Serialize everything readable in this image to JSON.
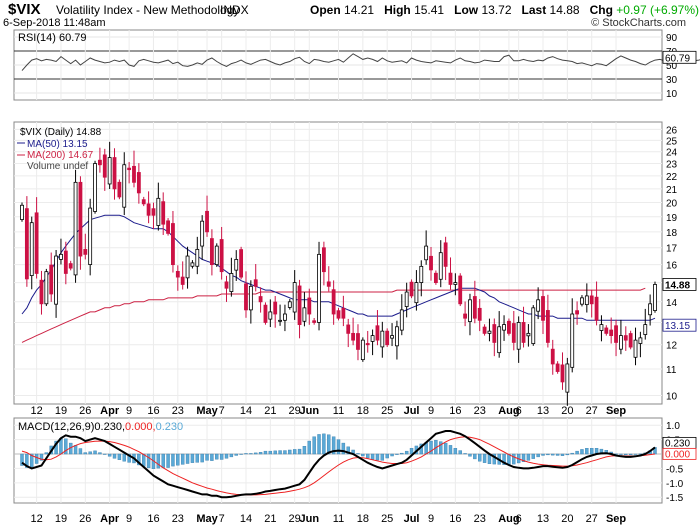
{
  "header": {
    "symbol": "$VIX",
    "name": "Volatility Index - New Methodology",
    "exchange": "INDX",
    "datetime": "6-Sep-2018 11:48am",
    "copyright": "© StockCharts.com",
    "open_label": "Open",
    "open": "14.21",
    "high_label": "High",
    "high": "15.41",
    "low_label": "Low",
    "low": "13.72",
    "last_label": "Last",
    "last": "14.88",
    "chg_label": "Chg",
    "chg": "+0.97 (+6.97%)"
  },
  "colors": {
    "up": "#00aa00",
    "bar_up": "#ffffff",
    "bar_down": "#cc1144",
    "ma50": "#1c1c8c",
    "ma200": "#cc2244",
    "macd_hist": "#5aa9d6",
    "macd_line": "#000000",
    "macd_signal": "#ee2222"
  },
  "chart_data": [
    {
      "type": "line",
      "panel": "rsi",
      "label": "RSI(14) 60.79",
      "y_ticks": [
        90,
        70,
        50,
        30,
        10
      ],
      "ylim": [
        0,
        100
      ],
      "reference_lines": [
        70,
        30
      ],
      "last_value_tag": "60.79",
      "values": [
        42,
        50,
        57,
        59,
        56,
        58,
        57,
        55,
        62,
        57,
        52,
        57,
        50,
        55,
        60,
        57,
        55,
        53,
        54,
        57,
        55,
        57,
        50,
        48,
        56,
        58,
        56,
        54,
        53,
        55,
        57,
        52,
        54,
        49,
        48,
        50,
        53,
        51,
        57,
        60,
        55,
        51,
        48,
        52,
        54,
        57,
        53,
        51,
        54,
        57,
        58,
        55,
        52,
        50,
        53,
        55,
        59,
        61,
        55,
        52,
        58,
        57,
        55,
        54,
        56,
        58,
        54,
        60,
        66,
        62,
        58,
        60,
        58,
        55,
        60,
        56,
        54,
        55,
        56,
        53,
        60,
        57,
        55,
        54,
        53,
        56,
        55,
        54,
        53,
        57,
        60,
        56,
        55,
        53,
        54,
        57,
        56,
        55,
        55,
        62,
        64,
        56,
        56,
        58,
        56,
        55,
        57,
        56,
        60,
        62,
        59,
        57,
        56,
        55,
        52,
        53,
        51,
        49,
        52,
        51,
        49,
        54,
        59,
        63,
        60,
        57,
        55,
        52,
        50,
        54,
        57,
        58,
        56,
        55,
        58,
        55,
        53,
        56,
        56,
        57,
        59,
        61
      ]
    },
    {
      "type": "candlestick",
      "panel": "price",
      "legend": [
        "$VIX (Daily) 14.88",
        "MA(50) 13.15",
        "MA(200) 14.67",
        "Volume undef"
      ],
      "y_ticks": [
        26,
        25,
        24,
        23,
        22,
        21,
        20,
        19,
        18,
        17,
        16,
        15,
        14,
        13,
        12,
        11,
        10
      ],
      "y_scale": "log",
      "ylim": [
        9.7,
        26.7
      ],
      "last_tags": {
        "price": "14.88",
        "ma50": "13.15"
      },
      "close": [
        19.8,
        15.2,
        18.6,
        15.5,
        13.9,
        15.6,
        14.4,
        16.5,
        16.6,
        15.5,
        15.8,
        21.5,
        16.5,
        16.6,
        19.6,
        23.0,
        22.9,
        21.9,
        23.5,
        21.0,
        20.4,
        22.9,
        22.5,
        21.5,
        20.7,
        19.9,
        19.1,
        19.1,
        20.3,
        18.5,
        17.9,
        16.0,
        15.3,
        14.9,
        16.5,
        16.1,
        16.9,
        18.7,
        18.0,
        16.0,
        17.1,
        15.6,
        14.7,
        15.5,
        16.3,
        15.3,
        13.6,
        14.8,
        14.8,
        14.0,
        13.0,
        13.5,
        13.4,
        13.1,
        13.4,
        14.0,
        15.0,
        12.9,
        13.7,
        13.4,
        13.0,
        16.6,
        15.6,
        14.8,
        13.4,
        13.2,
        13.2,
        12.5,
        12.2,
        11.8,
        12.2,
        12.0,
        12.4,
        12.2,
        12.6,
        12.0,
        12.4,
        12.8,
        13.6,
        14.5,
        14.3,
        15.0,
        15.9,
        17.1,
        15.7,
        15.0,
        16.7,
        15.9,
        14.9,
        15.0,
        13.9,
        13.2,
        14.1,
        13.2,
        13.1,
        12.5,
        12.6,
        12.1,
        12.8,
        12.9,
        12.5,
        12.1,
        13.0,
        12.1,
        12.5,
        13.7,
        14.1,
        13.1,
        12.1,
        11.2,
        10.9,
        10.5,
        11.2,
        13.4,
        13.4,
        14.2,
        14.3,
        13.9,
        13.1,
        12.9,
        12.5,
        12.4,
        12.1,
        12.4,
        12.2,
        11.9,
        12.2,
        12.3,
        12.9,
        13.9,
        14.9
      ],
      "ma50": [
        13.4,
        13.7,
        14.2,
        14.6,
        14.9,
        15.3,
        15.7,
        16.2,
        16.7,
        17.1,
        17.5,
        17.9,
        18.2,
        18.5,
        18.8,
        18.9,
        19.0,
        19.1,
        19.1,
        19.1,
        19.1,
        19.0,
        18.8,
        18.6,
        18.5,
        18.4,
        18.3,
        18.2,
        18.2,
        18.2,
        18.0,
        17.7,
        17.4,
        17.1,
        16.9,
        16.7,
        16.5,
        16.3,
        16.2,
        16.1,
        16.0,
        15.8,
        15.6,
        15.4,
        15.3,
        15.1,
        15.0,
        14.9,
        14.8,
        14.7,
        14.6,
        14.6,
        14.5,
        14.4,
        14.3,
        14.2,
        14.1,
        14.1,
        14.1,
        14.1,
        14.0,
        14.0,
        14.0,
        14.0,
        13.9,
        13.8,
        13.7,
        13.6,
        13.5,
        13.4,
        13.4,
        13.3,
        13.3,
        13.3,
        13.3,
        13.3,
        13.3,
        13.4,
        13.5,
        13.6,
        13.7,
        13.8,
        13.9,
        14.0,
        14.1,
        14.2,
        14.3,
        14.4,
        14.5,
        14.6,
        14.7,
        14.7,
        14.7,
        14.7,
        14.6,
        14.5,
        14.3,
        14.2,
        14.0,
        13.9,
        13.8,
        13.7,
        13.6,
        13.5,
        13.4,
        13.4,
        13.3,
        13.3,
        13.3,
        13.3,
        13.2,
        13.2,
        13.2,
        13.2,
        13.2,
        13.2,
        13.1,
        13.1,
        13.1,
        13.1,
        13.1,
        13.1,
        13.1,
        13.1,
        13.1,
        13.1,
        13.1,
        13.1,
        13.1,
        13.1,
        13.2
      ],
      "ma200": [
        12.1,
        12.2,
        12.3,
        12.4,
        12.5,
        12.6,
        12.7,
        12.8,
        12.9,
        13.0,
        13.1,
        13.2,
        13.3,
        13.4,
        13.5,
        13.5,
        13.6,
        13.7,
        13.7,
        13.8,
        13.8,
        13.9,
        13.9,
        14.0,
        14.0,
        14.0,
        14.1,
        14.1,
        14.1,
        14.1,
        14.2,
        14.2,
        14.2,
        14.2,
        14.2,
        14.2,
        14.3,
        14.3,
        14.3,
        14.3,
        14.3,
        14.4,
        14.4,
        14.4,
        14.4,
        14.4,
        14.4,
        14.4,
        14.4,
        14.5,
        14.5,
        14.5,
        14.5,
        14.5,
        14.5,
        14.5,
        14.5,
        14.5,
        14.5,
        14.5,
        14.5,
        14.5,
        14.5,
        14.5,
        14.5,
        14.5,
        14.5,
        14.5,
        14.5,
        14.5,
        14.5,
        14.5,
        14.5,
        14.5,
        14.5,
        14.5,
        14.5,
        14.6,
        14.6,
        14.6,
        14.6,
        14.6,
        14.6,
        14.6,
        14.6,
        14.6,
        14.6,
        14.6,
        14.6,
        14.6,
        14.6,
        14.6,
        14.6,
        14.6,
        14.6,
        14.6,
        14.6,
        14.6,
        14.6,
        14.6,
        14.6,
        14.6,
        14.6,
        14.6,
        14.6,
        14.6,
        14.6,
        14.6,
        14.6,
        14.6,
        14.6,
        14.6,
        14.6,
        14.6,
        14.6,
        14.6,
        14.6,
        14.6,
        14.6,
        14.6,
        14.6,
        14.6,
        14.6,
        14.6,
        14.6,
        14.6,
        14.6,
        14.6,
        14.7
      ]
    },
    {
      "type": "line",
      "panel": "macd",
      "label_prefix": "MACD(12,26,9)",
      "label_value1": "0.230,",
      "label_value2": "0.000,",
      "label_value3": "0.230",
      "y_ticks": [
        1.0,
        0.5,
        0.0,
        -0.5,
        -1.0,
        -1.5
      ],
      "ylim": [
        -1.7,
        1.25
      ],
      "last_tags": [
        "0.230",
        "0.000"
      ],
      "macd": [
        -0.3,
        -0.42,
        -0.5,
        -0.45,
        -0.4,
        -0.15,
        0.1,
        0.35,
        0.55,
        0.65,
        0.6,
        0.6,
        0.55,
        0.45,
        0.5,
        0.55,
        0.5,
        0.45,
        0.35,
        0.25,
        0.15,
        0.05,
        -0.05,
        -0.15,
        -0.3,
        -0.45,
        -0.6,
        -0.75,
        -0.85,
        -0.95,
        -1.05,
        -1.1,
        -1.15,
        -1.2,
        -1.25,
        -1.3,
        -1.35,
        -1.4,
        -1.4,
        -1.45,
        -1.45,
        -1.5,
        -1.5,
        -1.48,
        -1.45,
        -1.42,
        -1.4,
        -1.4,
        -1.38,
        -1.35,
        -1.3,
        -1.28,
        -1.25,
        -1.22,
        -1.2,
        -1.15,
        -1.1,
        -1.05,
        -0.9,
        -0.65,
        -0.4,
        -0.2,
        -0.05,
        0.05,
        0.1,
        0.12,
        0.1,
        0.05,
        0.0,
        -0.1,
        -0.2,
        -0.3,
        -0.38,
        -0.45,
        -0.5,
        -0.45,
        -0.4,
        -0.35,
        -0.3,
        -0.2,
        -0.05,
        0.1,
        0.25,
        0.4,
        0.55,
        0.7,
        0.75,
        0.8,
        0.8,
        0.75,
        0.7,
        0.62,
        0.5,
        0.38,
        0.25,
        0.12,
        0.0,
        -0.1,
        -0.2,
        -0.3,
        -0.38,
        -0.45,
        -0.48,
        -0.5,
        -0.5,
        -0.48,
        -0.45,
        -0.42,
        -0.42,
        -0.44,
        -0.46,
        -0.48,
        -0.45,
        -0.38,
        -0.28,
        -0.18,
        -0.1,
        -0.05,
        0.0,
        0.02,
        0.03,
        0.0,
        -0.05,
        -0.08,
        -0.1,
        -0.1,
        -0.08,
        -0.05,
        0.0,
        0.1,
        0.23
      ],
      "signal": [
        0.1,
        0.05,
        -0.05,
        -0.12,
        -0.18,
        -0.2,
        -0.18,
        -0.1,
        0.0,
        0.12,
        0.22,
        0.3,
        0.36,
        0.4,
        0.42,
        0.44,
        0.45,
        0.45,
        0.43,
        0.4,
        0.35,
        0.3,
        0.24,
        0.16,
        0.08,
        -0.02,
        -0.12,
        -0.24,
        -0.36,
        -0.48,
        -0.58,
        -0.68,
        -0.76,
        -0.84,
        -0.92,
        -1.0,
        -1.06,
        -1.12,
        -1.18,
        -1.22,
        -1.27,
        -1.31,
        -1.35,
        -1.38,
        -1.4,
        -1.41,
        -1.42,
        -1.42,
        -1.42,
        -1.41,
        -1.4,
        -1.38,
        -1.36,
        -1.34,
        -1.32,
        -1.29,
        -1.26,
        -1.22,
        -1.17,
        -1.1,
        -1.0,
        -0.88,
        -0.75,
        -0.62,
        -0.5,
        -0.38,
        -0.28,
        -0.2,
        -0.14,
        -0.12,
        -0.13,
        -0.16,
        -0.2,
        -0.24,
        -0.28,
        -0.31,
        -0.33,
        -0.33,
        -0.33,
        -0.3,
        -0.25,
        -0.18,
        -0.1,
        0.0,
        0.1,
        0.22,
        0.32,
        0.42,
        0.5,
        0.55,
        0.58,
        0.6,
        0.58,
        0.55,
        0.5,
        0.42,
        0.34,
        0.25,
        0.16,
        0.07,
        -0.02,
        -0.1,
        -0.17,
        -0.23,
        -0.28,
        -0.32,
        -0.35,
        -0.37,
        -0.39,
        -0.4,
        -0.41,
        -0.42,
        -0.42,
        -0.41,
        -0.38,
        -0.34,
        -0.3,
        -0.25,
        -0.2,
        -0.15,
        -0.1,
        -0.07,
        -0.06,
        -0.06,
        -0.07,
        -0.07,
        -0.07,
        -0.06,
        -0.04,
        -0.02,
        0.0
      ]
    }
  ],
  "x_axis": {
    "labels": [
      {
        "text": "12",
        "bold": false,
        "i": 3
      },
      {
        "text": "19",
        "bold": false,
        "i": 8
      },
      {
        "text": "26",
        "bold": false,
        "i": 13
      },
      {
        "text": "Apr",
        "bold": true,
        "i": 18
      },
      {
        "text": "9",
        "bold": false,
        "i": 22
      },
      {
        "text": "16",
        "bold": false,
        "i": 27
      },
      {
        "text": "23",
        "bold": false,
        "i": 32
      },
      {
        "text": "May",
        "bold": true,
        "i": 38
      },
      {
        "text": "7",
        "bold": false,
        "i": 41
      },
      {
        "text": "14",
        "bold": false,
        "i": 46
      },
      {
        "text": "21",
        "bold": false,
        "i": 51
      },
      {
        "text": "29",
        "bold": false,
        "i": 56
      },
      {
        "text": "Jun",
        "bold": true,
        "i": 59
      },
      {
        "text": "11",
        "bold": false,
        "i": 65
      },
      {
        "text": "18",
        "bold": false,
        "i": 70
      },
      {
        "text": "25",
        "bold": false,
        "i": 75
      },
      {
        "text": "Jul",
        "bold": true,
        "i": 80
      },
      {
        "text": "9",
        "bold": false,
        "i": 84
      },
      {
        "text": "16",
        "bold": false,
        "i": 89
      },
      {
        "text": "23",
        "bold": false,
        "i": 94
      },
      {
        "text": "Aug",
        "bold": true,
        "i": 100
      },
      {
        "text": "6",
        "bold": false,
        "i": 102
      },
      {
        "text": "13",
        "bold": false,
        "i": 107
      },
      {
        "text": "20",
        "bold": false,
        "i": 112
      },
      {
        "text": "27",
        "bold": false,
        "i": 117
      },
      {
        "text": "Sep",
        "bold": true,
        "i": 122
      }
    ]
  }
}
